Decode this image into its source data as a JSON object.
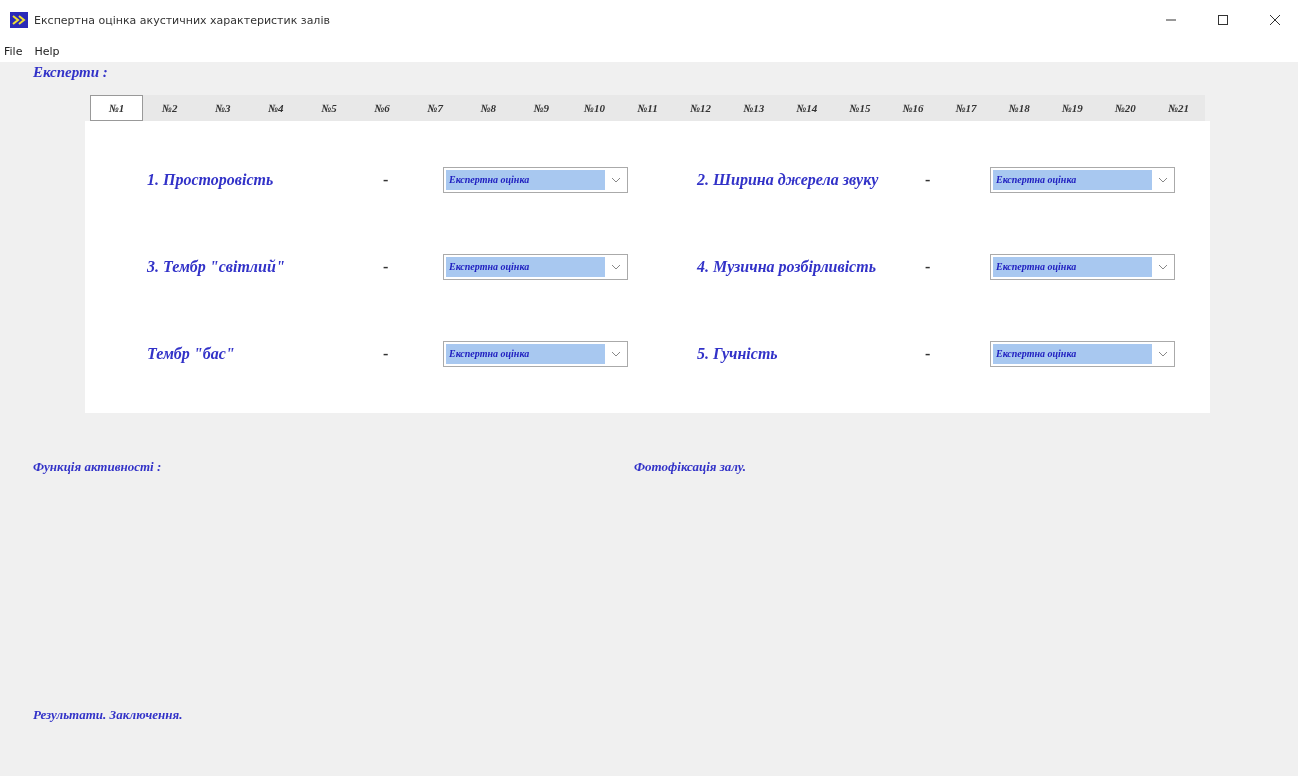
{
  "window": {
    "title": "Експертна оцінка акустичних характеристик залів"
  },
  "menu": [
    "File",
    "Help"
  ],
  "experts_label": "Експерти :",
  "tabs": [
    {
      "label": "№1",
      "selected": true
    },
    {
      "label": "№2",
      "selected": false
    },
    {
      "label": "№3",
      "selected": false
    },
    {
      "label": "№4",
      "selected": false
    },
    {
      "label": "№5",
      "selected": false
    },
    {
      "label": "№6",
      "selected": false
    },
    {
      "label": "№7",
      "selected": false
    },
    {
      "label": "№8",
      "selected": false
    },
    {
      "label": "№9",
      "selected": false
    },
    {
      "label": "№10",
      "selected": false
    },
    {
      "label": "№11",
      "selected": false
    },
    {
      "label": "№12",
      "selected": false
    },
    {
      "label": "№13",
      "selected": false
    },
    {
      "label": "№14",
      "selected": false
    },
    {
      "label": "№15",
      "selected": false
    },
    {
      "label": "№16",
      "selected": false
    },
    {
      "label": "№17",
      "selected": false
    },
    {
      "label": "№18",
      "selected": false
    },
    {
      "label": "№19",
      "selected": false
    },
    {
      "label": "№20",
      "selected": false
    },
    {
      "label": "№21",
      "selected": false
    }
  ],
  "criteria": [
    {
      "label": "1. Просторовість",
      "dash": "-",
      "value": "Експертна оцінка"
    },
    {
      "label": "2. Ширина джерела звуку",
      "dash": "-",
      "value": "Експертна оцінка"
    },
    {
      "label": "3. Тембр \"світлий\"",
      "dash": "-",
      "value": "Експертна оцінка"
    },
    {
      "label": "4. Музична розбірливість",
      "dash": "-",
      "value": "Експертна оцінка"
    },
    {
      "label": "Тембр \"бас\"",
      "dash": "-",
      "value": "Експертна оцінка"
    },
    {
      "label": "5. Гучність",
      "dash": "-",
      "value": "Експертна оцінка"
    }
  ],
  "activity_label": "Функція активності :",
  "photo_label": "Фотофіксація залу.",
  "results_label": "Результати.  Заключення."
}
